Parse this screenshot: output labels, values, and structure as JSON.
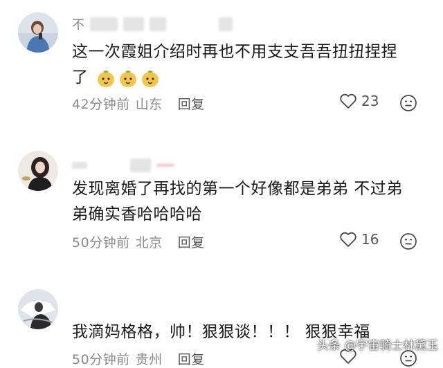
{
  "comments": [
    {
      "text_lines": [
        "这一次霞姐介绍时再也不用支支吾吾扭扭捏捏",
        "了"
      ],
      "emoji": [
        "mango-emoji",
        "mango-emoji",
        "mango-emoji"
      ],
      "time": "42分钟前",
      "location": "山东",
      "reply": "回复",
      "likes": "23",
      "name_prefix": "不"
    },
    {
      "text_lines": [
        "发现离婚了再找的第一个好像都是弟弟 不过弟",
        "弟确实香哈哈哈哈"
      ],
      "time": "50分钟前",
      "location": "北京",
      "reply": "回复",
      "likes": "16"
    },
    {
      "text_lines": [
        "我滴妈格格，帅！狠狠谈！！！ 狠狠幸福"
      ],
      "time": "50分钟前",
      "location": "贵州",
      "reply": "回复"
    }
  ],
  "watermark": "头条 @宇宙骑士林黛玉",
  "icons": {
    "like": "heart-outline-icon",
    "react": "neutral-face-icon"
  }
}
